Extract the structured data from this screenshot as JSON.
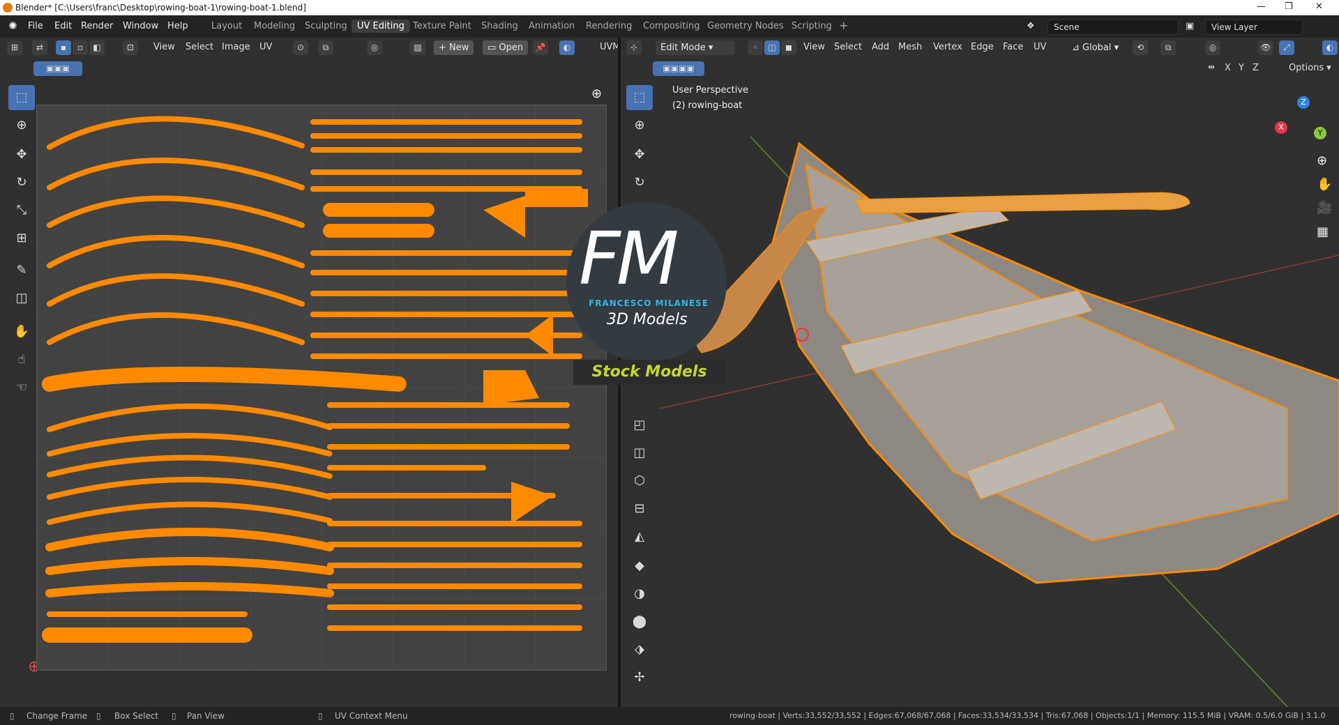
{
  "window": {
    "title": "Blender* [C:\\Users\\franc\\Desktop\\rowing-boat-1\\rowing-boat-1.blend]",
    "controls": [
      "—",
      "❐",
      "✕"
    ]
  },
  "menu": [
    "File",
    "Edit",
    "Render",
    "Window",
    "Help"
  ],
  "workspaces": [
    "Layout",
    "Modeling",
    "Sculpting",
    "UV Editing",
    "Texture Paint",
    "Shading",
    "Animation",
    "Rendering",
    "Compositing",
    "Geometry Nodes",
    "Scripting"
  ],
  "active_workspace": "UV Editing",
  "add_workspace": "+",
  "scene": {
    "label": "Scene"
  },
  "view_layer": {
    "label": "View Layer"
  },
  "uv_editor": {
    "menus": [
      "View",
      "Select",
      "Image",
      "UV"
    ],
    "new_label": "New",
    "open_label": "Open",
    "truncated_label": "UVM"
  },
  "viewport": {
    "mode": "Edit Mode",
    "menus": [
      "View",
      "Select",
      "Add",
      "Mesh",
      "Vertex",
      "Edge",
      "Face",
      "UV"
    ],
    "transform": "Global",
    "axes": [
      "X",
      "Y",
      "Z"
    ],
    "options_label": "Options",
    "overlay_line1": "User Perspective",
    "overlay_line2": "(2) rowing-boat",
    "gizmo": {
      "z": "Z",
      "y": "Y",
      "x": "X"
    }
  },
  "watermark": {
    "letters": "FM",
    "name": "FRANCESCO MILANESE",
    "sub": "3D Models",
    "badge": "Stock Models"
  },
  "status": {
    "left": [
      "Change Frame",
      "Box Select",
      "Pan View"
    ],
    "uv_context": "UV Context Menu",
    "stats": "rowing-boat | Verts:33,552/33,552 | Edges:67,068/67,068 | Faces:33,534/33,534 | Tris:67,068 | Objects:1/1 | Memory: 115.5 MiB | VRAM: 0.5/6.0 GiB | 3.1.0"
  },
  "colors": {
    "accent": "#4772b3",
    "selection": "#ff8a00",
    "title_orange": "#e87d0d"
  }
}
